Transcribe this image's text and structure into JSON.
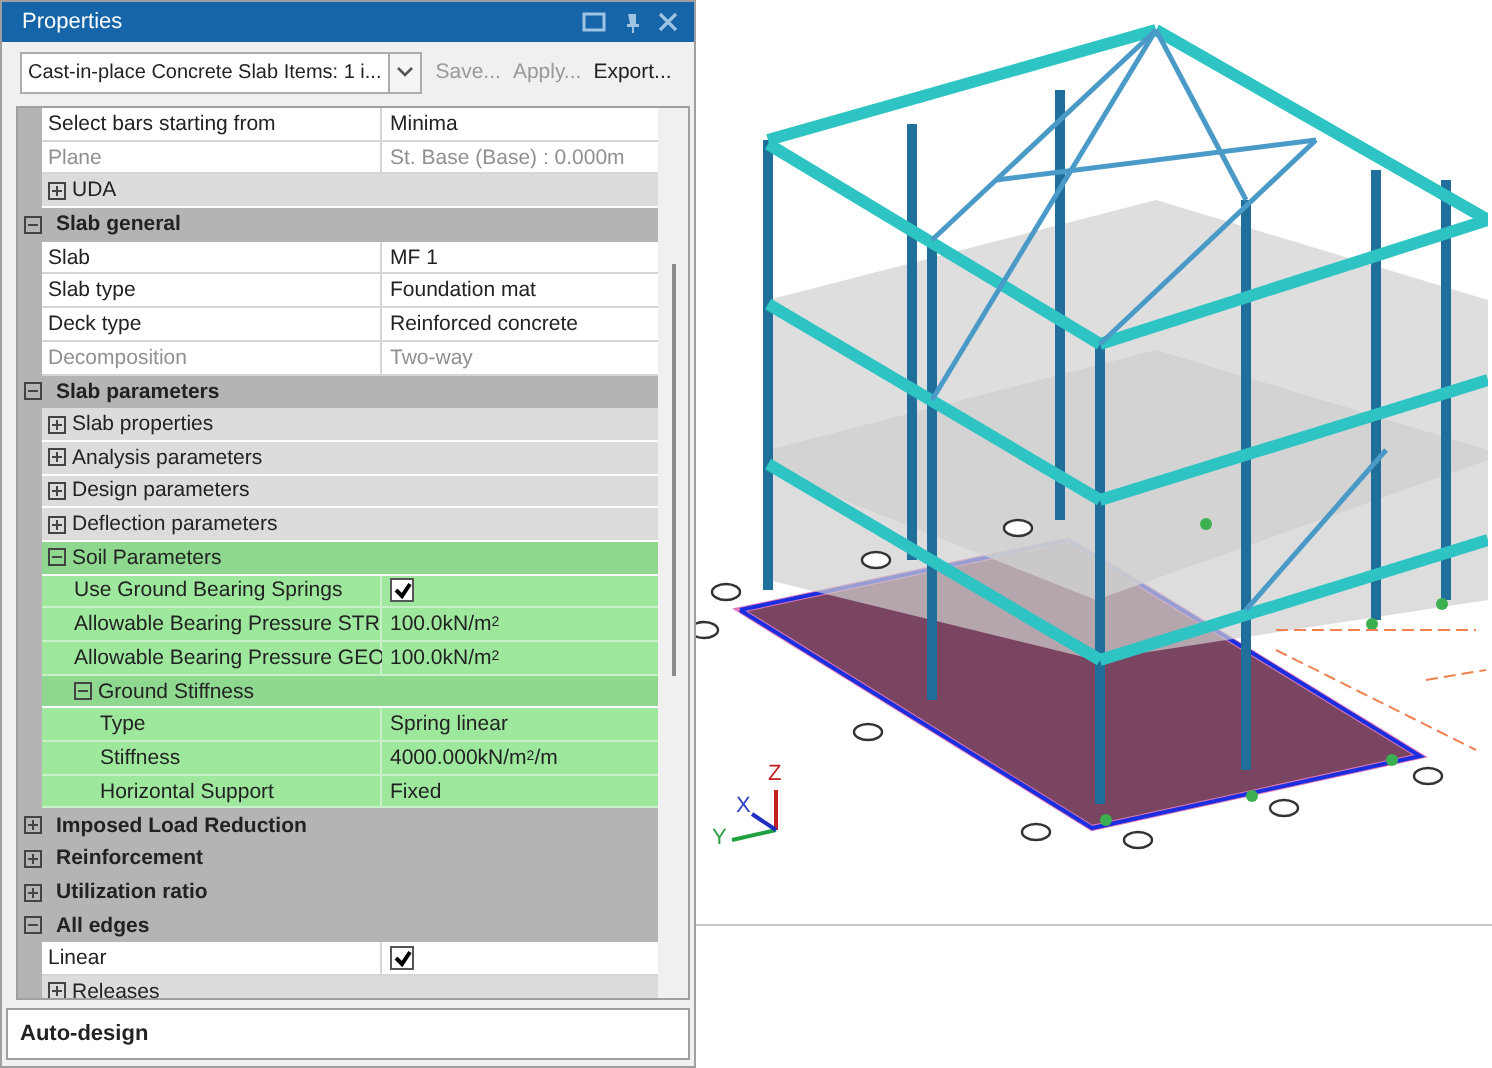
{
  "panel": {
    "title": "Properties",
    "selector": {
      "value": "Cast-in-place Concrete Slab Items: 1 i..."
    },
    "actions": [
      {
        "label": "Save...",
        "disabled": true
      },
      {
        "label": "Apply...",
        "disabled": true
      },
      {
        "label": "Export...",
        "disabled": false
      }
    ],
    "grid": [
      {
        "kind": "property",
        "name": "Select bars starting from",
        "value": "Minima",
        "disabled": false
      },
      {
        "kind": "property",
        "name": "Plane",
        "value": "St. Base (Base) : 0.000m",
        "disabled": true
      },
      {
        "kind": "group",
        "name": "UDA",
        "expanded": false,
        "highlighted": false
      },
      {
        "kind": "category",
        "name": "Slab general",
        "expanded": true,
        "children": [
          {
            "kind": "property",
            "name": "Slab",
            "value": "MF 1",
            "disabled": false
          },
          {
            "kind": "property",
            "name": "Slab type",
            "value": "Foundation mat",
            "disabled": false
          },
          {
            "kind": "property",
            "name": "Deck type",
            "value": "Reinforced concrete",
            "disabled": false
          },
          {
            "kind": "property",
            "name": "Decomposition",
            "value": "Two-way",
            "disabled": true
          }
        ]
      },
      {
        "kind": "category",
        "name": "Slab parameters",
        "expanded": true,
        "children": [
          {
            "kind": "group",
            "name": "Slab properties",
            "expanded": false,
            "highlighted": false
          },
          {
            "kind": "group",
            "name": "Analysis parameters",
            "expanded": false,
            "highlighted": false
          },
          {
            "kind": "group",
            "name": "Design parameters",
            "expanded": false,
            "highlighted": false
          },
          {
            "kind": "group",
            "name": "Deflection parameters",
            "expanded": false,
            "highlighted": false
          },
          {
            "kind": "group",
            "name": "Soil Parameters",
            "expanded": true,
            "highlighted": true,
            "children": [
              {
                "kind": "checkbox",
                "name": "Use Ground Bearing Springs",
                "checked": true
              },
              {
                "kind": "property",
                "name": "Allowable Bearing Pressure STR",
                "value": "100.0kN/m$^{2}$",
                "disabled": false
              },
              {
                "kind": "property",
                "name": "Allowable Bearing Pressure GEO",
                "value": "100.0kN/m$^{2}$",
                "disabled": false
              },
              {
                "kind": "group",
                "name": "Ground Stiffness",
                "expanded": true,
                "highlighted": true,
                "children": [
                  {
                    "kind": "property",
                    "name": "Type",
                    "value": "Spring linear",
                    "disabled": false
                  },
                  {
                    "kind": "property",
                    "name": "Stiffness",
                    "value": "4000.000kN/m$^{2}$/m",
                    "disabled": false
                  },
                  {
                    "kind": "property",
                    "name": "Horizontal Support",
                    "value": "Fixed",
                    "disabled": false
                  }
                ]
              }
            ]
          }
        ]
      },
      {
        "kind": "category",
        "name": "Imposed Load Reduction",
        "expanded": false
      },
      {
        "kind": "category",
        "name": "Reinforcement",
        "expanded": false
      },
      {
        "kind": "category",
        "name": "Utilization ratio",
        "expanded": false
      },
      {
        "kind": "category",
        "name": "All edges",
        "expanded": true,
        "children": [
          {
            "kind": "checkbox",
            "name": "Linear",
            "checked": true
          },
          {
            "kind": "group",
            "name": "Releases",
            "expanded": false,
            "highlighted": false
          }
        ]
      }
    ],
    "footer": "Auto-design"
  },
  "viewport": {
    "axes": {
      "x": "X",
      "y": "Y",
      "z": "Z"
    }
  }
}
